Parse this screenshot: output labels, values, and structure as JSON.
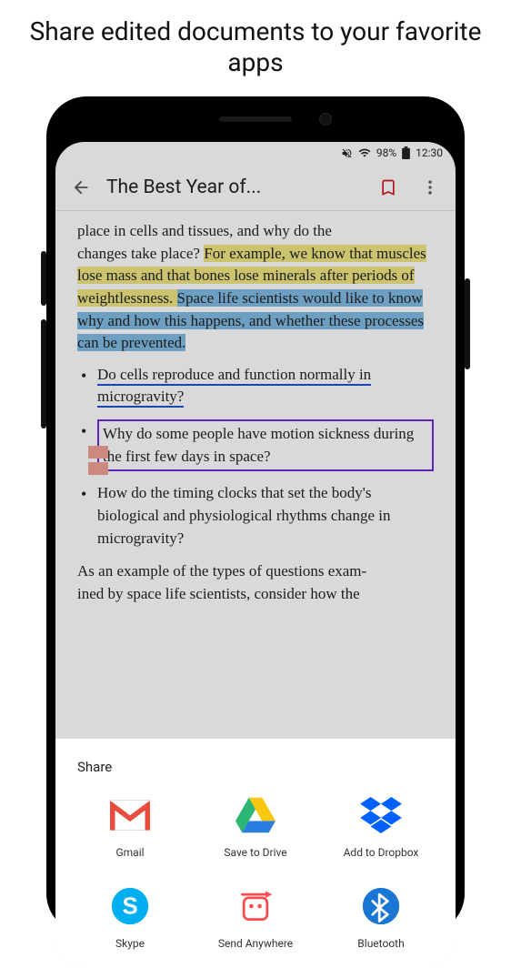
{
  "promo": {
    "title": "Share edited documents to your favorite apps"
  },
  "status": {
    "battery_pct": "98%",
    "time": "12:30"
  },
  "appbar": {
    "title": "The Best Year of..."
  },
  "doc": {
    "line0a": "place in cells and tissues, and why do the",
    "line0b": "changes take place? ",
    "hl_yellow": "For example, we know that muscles lose mass and that bones lose minerals after periods of weightlessness. ",
    "hl_blue": "Space life scientists would like to know why and how this happens, and whether these processes can be prevented.",
    "bullet1": "Do cells reproduce and function normally in microgravity?",
    "bullet2": "Why do some people have motion sickness during the first few days in space?",
    "bullet3": "How do the timing clocks that set the body's biological and physiological rhythms change in microgravity?",
    "para2a": "As an example of the types of questions exam-",
    "para2b": "ined by space life scientists, consider how the"
  },
  "share": {
    "title": "Share",
    "items": [
      {
        "label": "Gmail"
      },
      {
        "label": "Save to Drive"
      },
      {
        "label": "Add to Dropbox"
      },
      {
        "label": "Skype"
      },
      {
        "label": "Send Anywhere"
      },
      {
        "label": "Bluetooth"
      }
    ]
  }
}
